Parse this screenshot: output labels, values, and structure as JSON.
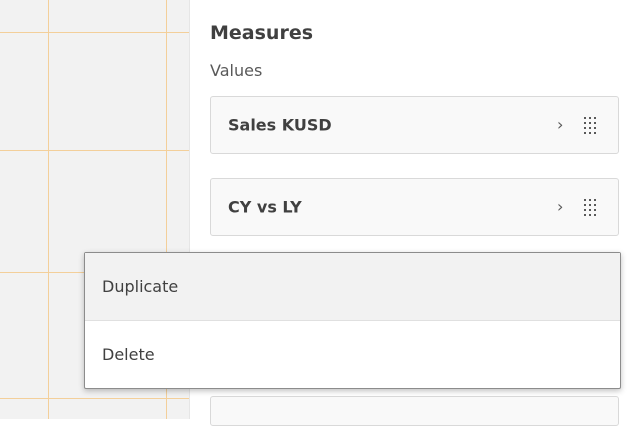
{
  "panel": {
    "title": "Measures",
    "subtitle": "Values",
    "measures": [
      {
        "label": "Sales KUSD",
        "chevron": "›",
        "handle_icon": "drag-handle-icon"
      },
      {
        "label": "CY vs LY",
        "chevron": "›",
        "handle_icon": "drag-handle-icon"
      }
    ]
  },
  "context_menu": {
    "items": [
      {
        "label": "Duplicate",
        "state": "hovered"
      },
      {
        "label": "Delete",
        "state": "normal"
      }
    ]
  },
  "colors": {
    "canvas_background": "#f2f2f2",
    "grid_line": "#f3cf9a",
    "card_border": "#d9d9d9",
    "menu_border": "#8c8c8c",
    "menu_hover": "#f2f2f2"
  }
}
